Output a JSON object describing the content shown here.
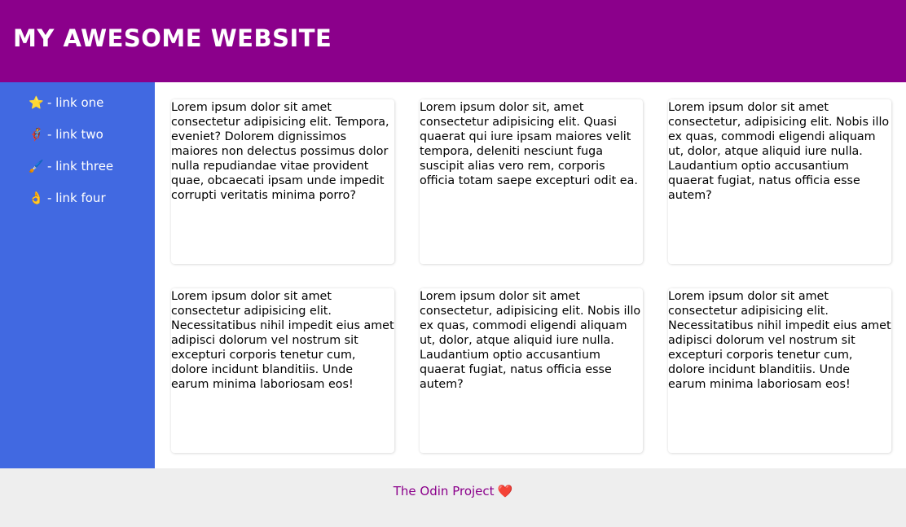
{
  "header": {
    "title": "MY AWESOME WEBSITE"
  },
  "sidebar": {
    "links": [
      {
        "icon": "star-icon",
        "emoji": "⭐",
        "label": "- link one"
      },
      {
        "icon": "superhero-icon",
        "emoji": "🦸",
        "label": "- link two"
      },
      {
        "icon": "paintbrush-icon",
        "emoji": "🖌️",
        "label": "- link three"
      },
      {
        "icon": "ok-hand-icon",
        "emoji": "👌",
        "label": "- link four"
      }
    ]
  },
  "cards": [
    {
      "text": "Lorem ipsum dolor sit amet consectetur adipisicing elit. Tempora, eveniet? Dolorem dignissimos maiores non delectus possimus dolor nulla repudiandae vitae provident quae, obcaecati ipsam unde impedit corrupti veritatis minima porro?"
    },
    {
      "text": "Lorem ipsum dolor sit, amet consectetur adipisicing elit. Quasi quaerat qui iure ipsam maiores velit tempora, deleniti nesciunt fuga suscipit alias vero rem, corporis officia totam saepe excepturi odit ea."
    },
    {
      "text": "Lorem ipsum dolor sit amet consectetur, adipisicing elit. Nobis illo ex quas, commodi eligendi aliquam ut, dolor, atque aliquid iure nulla. Laudantium optio accusantium quaerat fugiat, natus officia esse autem?"
    },
    {
      "text": "Lorem ipsum dolor sit amet consectetur adipisicing elit. Necessitatibus nihil impedit eius amet adipisci dolorum vel nostrum sit excepturi corporis tenetur cum, dolore incidunt blanditiis. Unde earum minima laboriosam eos!"
    },
    {
      "text": "Lorem ipsum dolor sit amet consectetur, adipisicing elit. Nobis illo ex quas, commodi eligendi aliquam ut, dolor, atque aliquid iure nulla. Laudantium optio accusantium quaerat fugiat, natus officia esse autem?"
    },
    {
      "text": "Lorem ipsum dolor sit amet consectetur adipisicing elit. Necessitatibus nihil impedit eius amet adipisci dolorum vel nostrum sit excepturi corporis tenetur cum, dolore incidunt blanditiis. Unde earum minima laboriosam eos!"
    }
  ],
  "footer": {
    "link_text": "The Odin Project",
    "heart": "❤️"
  },
  "colors": {
    "header_bg": "#8b008b",
    "sidebar_bg": "#4169e1",
    "footer_bg": "#eeeeee",
    "footer_link": "#8b008b"
  }
}
